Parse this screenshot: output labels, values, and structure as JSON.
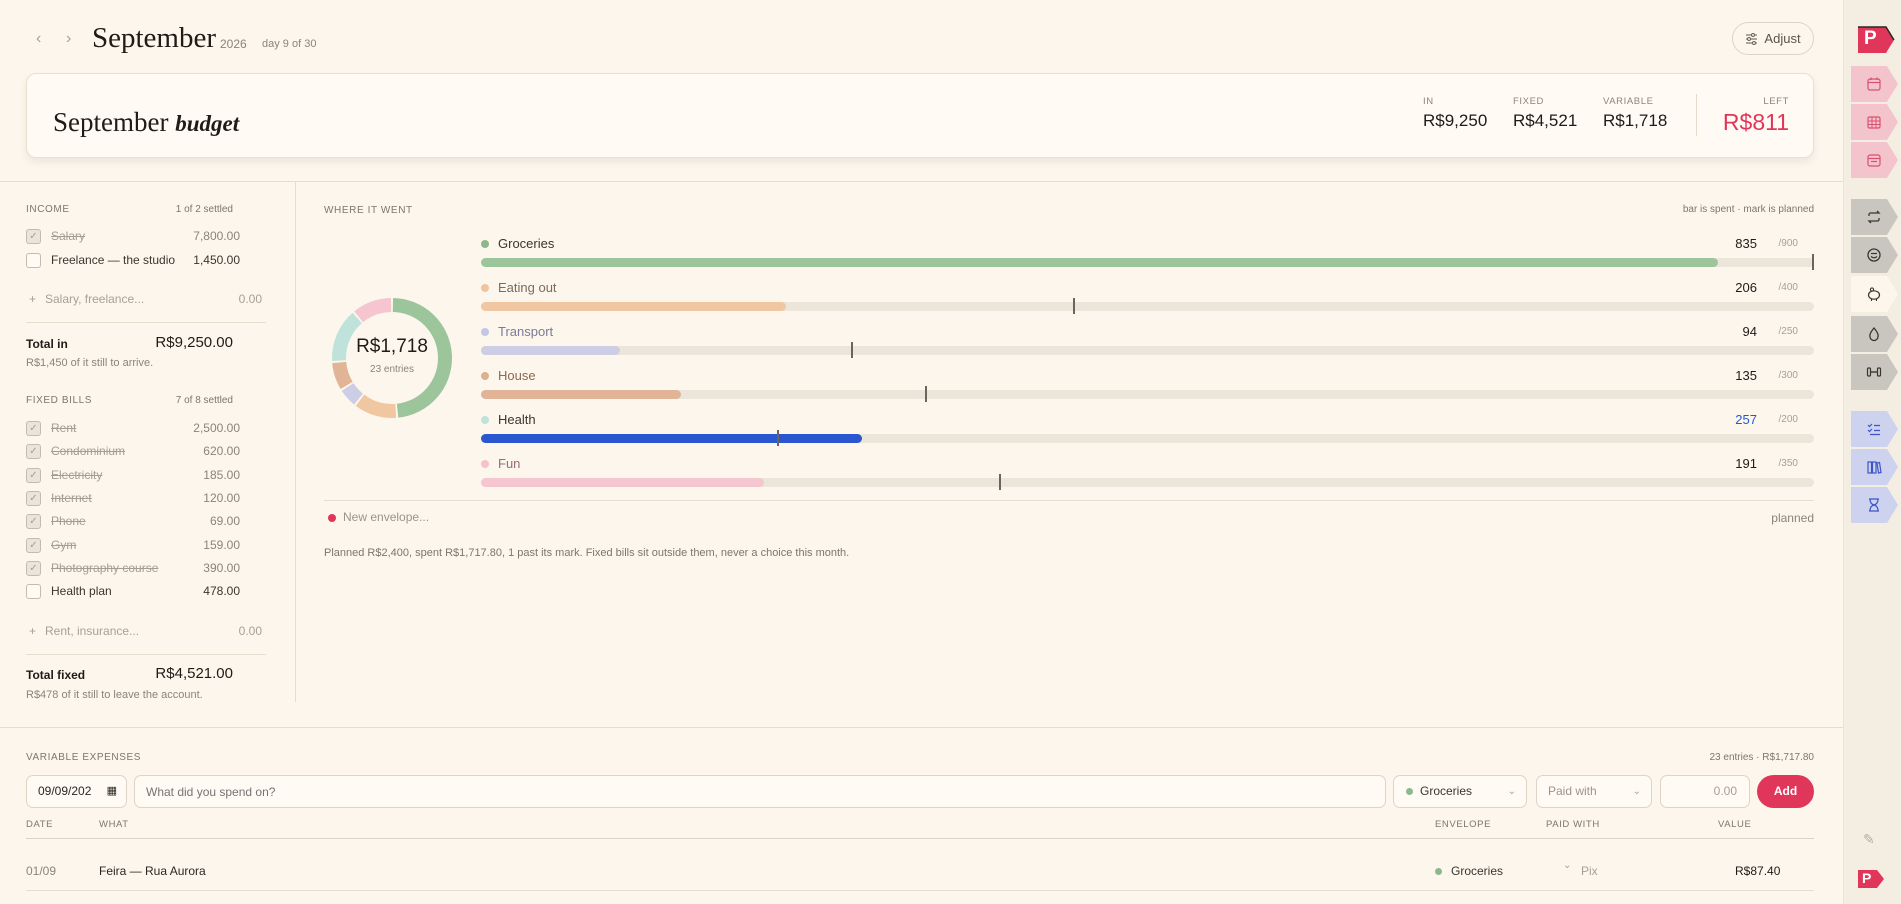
{
  "header": {
    "prev_icon": "chevron-left-icon",
    "next_icon": "chevron-right-icon",
    "month": "September",
    "year": "2026",
    "day_of": "day 9 of 30",
    "adjust_label": "Adjust",
    "adjust_icon": "sliders-icon"
  },
  "budget": {
    "title": "September",
    "title_script": "budget",
    "stats": {
      "in_label": "IN",
      "in_value": "R$9,250",
      "fixed_label": "FIXED",
      "fixed_value": "R$4,521",
      "variable_label": "VARIABLE",
      "variable_value": "R$1,718",
      "left_label": "LEFT",
      "left_value": "R$811"
    }
  },
  "income": {
    "label": "INCOME",
    "meta": "1 of 2 settled",
    "items": [
      {
        "name": "Salary",
        "amount": "7,800.00",
        "settled": true
      },
      {
        "name": "Freelance — the studio",
        "amount": "1,450.00",
        "settled": false
      }
    ],
    "add_placeholder": "Salary, freelance...",
    "add_amount": "0.00",
    "total_label": "Total in",
    "total_value": "R$9,250.00",
    "note": "R$1,450 of it still to arrive."
  },
  "fixed": {
    "label": "FIXED BILLS",
    "meta": "7 of 8 settled",
    "items": [
      {
        "name": "Rent",
        "amount": "2,500.00",
        "settled": true
      },
      {
        "name": "Condominium",
        "amount": "620.00",
        "settled": true
      },
      {
        "name": "Electricity",
        "amount": "185.00",
        "settled": true
      },
      {
        "name": "Internet",
        "amount": "120.00",
        "settled": true
      },
      {
        "name": "Phone",
        "amount": "69.00",
        "settled": true
      },
      {
        "name": "Gym",
        "amount": "159.00",
        "settled": true
      },
      {
        "name": "Photography course",
        "amount": "390.00",
        "settled": true
      },
      {
        "name": "Health plan",
        "amount": "478.00",
        "settled": false
      }
    ],
    "add_placeholder": "Rent, insurance...",
    "add_amount": "0.00",
    "total_label": "Total fixed",
    "total_value": "R$4,521.00",
    "note": "R$478 of it still to leave the account."
  },
  "where": {
    "label": "WHERE IT WENT",
    "legend": "bar is spent · mark is planned",
    "donut_total": "R$1,718",
    "donut_entries": "23 entries",
    "new_envelope": "New envelope...",
    "planned_label": "planned",
    "summary": "Planned R$2,400, spent R$1,717.80, 1 past its mark. Fixed bills sit outside them, never a choice this month."
  },
  "chart_data": {
    "type": "bar",
    "categories": [
      "Groceries",
      "Eating out",
      "Transport",
      "House",
      "Health",
      "Fun"
    ],
    "series": [
      {
        "name": "spent",
        "values": [
          835,
          206,
          94,
          135,
          257,
          191
        ]
      },
      {
        "name": "planned",
        "values": [
          900,
          400,
          250,
          300,
          200,
          350
        ]
      }
    ],
    "spent_labels": [
      "835",
      "206",
      "94",
      "135",
      "257",
      "191"
    ],
    "planned_labels": [
      "/900",
      "/400",
      "/250",
      "/300",
      "/200",
      "/350"
    ],
    "colors": [
      "#9dc59b",
      "#f1c7a2",
      "#cdcde6",
      "#e2b497",
      "#2a57cf",
      "#f5c6cf"
    ],
    "dot_colors": [
      "#8db88c",
      "#efc49e",
      "#c5c6e3",
      "#dfb090",
      "#bfe3da",
      "#f5c1cc"
    ],
    "name_colors": [
      "#3a352f",
      "#7d6b5c",
      "#7d7a98",
      "#8a6a52",
      "#3a352f",
      "#9b6a76"
    ],
    "donut_colors": [
      "#9dc59b",
      "#f1c7a2",
      "#cdcde6",
      "#e2b497",
      "#bfe3da",
      "#f5c6cf"
    ]
  },
  "variable": {
    "label": "VARIABLE EXPENSES",
    "meta": "23 entries · R$1,717.80",
    "date_value": "09/09/202",
    "what_placeholder": "What did you spend on?",
    "envelope_value": "Groceries",
    "paid_placeholder": "Paid with",
    "value_placeholder": "0.00",
    "add_label": "Add",
    "columns": {
      "date": "DATE",
      "what": "WHAT",
      "envelope": "ENVELOPE",
      "paid": "PAID WITH",
      "value": "VALUE"
    },
    "rows": [
      {
        "date": "01/09",
        "what": "Feira — Rua Aurora",
        "envelope": "Groceries",
        "paid": "Pix",
        "value": "R$87.40"
      }
    ]
  },
  "rail": {
    "logo": "P",
    "tabs": [
      {
        "icon": "calendar-day-icon",
        "color": "#f4c4cd",
        "stroke": "#d8506f"
      },
      {
        "icon": "calendar-grid-icon",
        "color": "#f4c4cd",
        "stroke": "#d8506f"
      },
      {
        "icon": "calendar-week-icon",
        "color": "#f4c4cd",
        "stroke": "#d8506f"
      },
      {
        "icon": "repeat-icon",
        "color": "#c9c6c0",
        "stroke": "#3a352f"
      },
      {
        "icon": "face-icon",
        "color": "#c9c6c0",
        "stroke": "#3a352f"
      },
      {
        "icon": "piggy-bank-icon",
        "color": "#fcf6ec",
        "stroke": "#3a352f"
      },
      {
        "icon": "drop-icon",
        "color": "#c9c6c0",
        "stroke": "#3a352f"
      },
      {
        "icon": "dumbbell-icon",
        "color": "#c9c6c0",
        "stroke": "#3a352f"
      },
      {
        "icon": "checklist-icon",
        "color": "#cdd2ee",
        "stroke": "#3d55c9"
      },
      {
        "icon": "books-icon",
        "color": "#cdd2ee",
        "stroke": "#3d55c9"
      },
      {
        "icon": "hourglass-icon",
        "color": "#cdd2ee",
        "stroke": "#3d55c9"
      }
    ],
    "pencil_icon": "pencil-icon"
  }
}
